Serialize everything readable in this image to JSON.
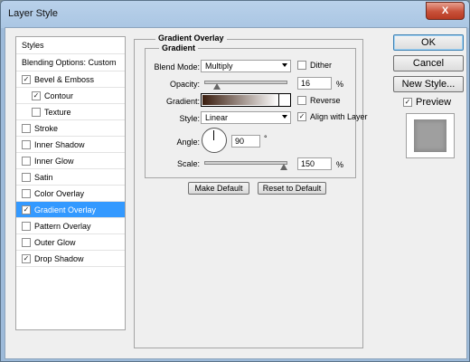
{
  "window": {
    "title": "Layer Style",
    "close_glyph": "X"
  },
  "styles_list": {
    "items": [
      {
        "label": "Styles",
        "type": "header"
      },
      {
        "label": "Blending Options: Custom",
        "type": "header"
      },
      {
        "label": "Bevel & Emboss",
        "checked": true
      },
      {
        "label": "Contour",
        "checked": true,
        "indent": true
      },
      {
        "label": "Texture",
        "checked": false,
        "indent": true
      },
      {
        "label": "Stroke",
        "checked": false
      },
      {
        "label": "Inner Shadow",
        "checked": false
      },
      {
        "label": "Inner Glow",
        "checked": false
      },
      {
        "label": "Satin",
        "checked": false
      },
      {
        "label": "Color Overlay",
        "checked": false
      },
      {
        "label": "Gradient Overlay",
        "checked": true,
        "selected": true
      },
      {
        "label": "Pattern Overlay",
        "checked": false
      },
      {
        "label": "Outer Glow",
        "checked": false
      },
      {
        "label": "Drop Shadow",
        "checked": true
      }
    ]
  },
  "panel": {
    "title": "Gradient Overlay",
    "subtitle": "Gradient",
    "blend_mode_label": "Blend Mode:",
    "blend_mode_value": "Multiply",
    "dither_label": "Dither",
    "opacity_label": "Opacity:",
    "opacity_value": "16",
    "opacity_unit": "%",
    "gradient_label": "Gradient:",
    "reverse_label": "Reverse",
    "style_label": "Style:",
    "style_value": "Linear",
    "align_label": "Align with Layer",
    "angle_label": "Angle:",
    "angle_value": "90",
    "angle_unit": "°",
    "scale_label": "Scale:",
    "scale_value": "150",
    "scale_unit": "%",
    "make_default_label": "Make Default",
    "reset_default_label": "Reset to Default",
    "gradient_colors": [
      "#3a1d0e",
      "#ffffff"
    ],
    "dither_checked": false,
    "reverse_checked": false,
    "align_checked": true
  },
  "buttons": {
    "ok_label": "OK",
    "cancel_label": "Cancel",
    "new_style_label": "New Style...",
    "preview_label": "Preview",
    "preview_checked": true
  }
}
